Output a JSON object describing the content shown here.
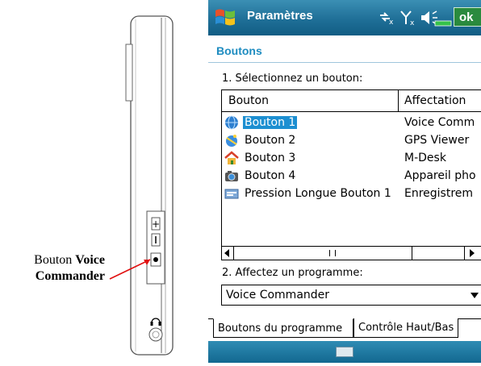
{
  "callout": {
    "prefix": "Bouton",
    "bold_line1": "Voice",
    "bold_line2": "Commander",
    "arrow_color": "#e01010"
  },
  "window": {
    "title": "Paramètres",
    "ok_label": "ok",
    "status_icons": [
      "connectivity-icon",
      "signal-icon",
      "speaker-muted-icon",
      "battery-icon"
    ]
  },
  "page": {
    "section_title": "Boutons",
    "step1_label": "1. Sélectionnez un bouton:",
    "columns": [
      "Bouton",
      "Affectation"
    ],
    "rows": [
      {
        "name": "Bouton 1",
        "assignment": "Voice Comm",
        "icon": "globe-icon",
        "selected": true
      },
      {
        "name": "Bouton 2",
        "assignment": "GPS Viewer",
        "icon": "satellite-globe-icon",
        "selected": false
      },
      {
        "name": "Bouton 3",
        "assignment": "M-Desk",
        "icon": "home-icon",
        "selected": false
      },
      {
        "name": "Bouton 4",
        "assignment": "Appareil pho",
        "icon": "camera-icon",
        "selected": false
      },
      {
        "name": "Pression Longue Bouton 1",
        "assignment": "Enregistrem",
        "icon": "recorder-icon",
        "selected": false
      }
    ],
    "step2_label": "2. Affectez un programme:",
    "program_value": "Voice Commander",
    "tabs": [
      "Boutons du programme",
      "Contrôle Haut/Bas"
    ],
    "active_tab": 0
  },
  "colors": {
    "titlebar": "#1f6f97",
    "accent": "#1e8cc0",
    "selection": "#1d8fd1",
    "ok_bg": "#2a8a3e"
  }
}
